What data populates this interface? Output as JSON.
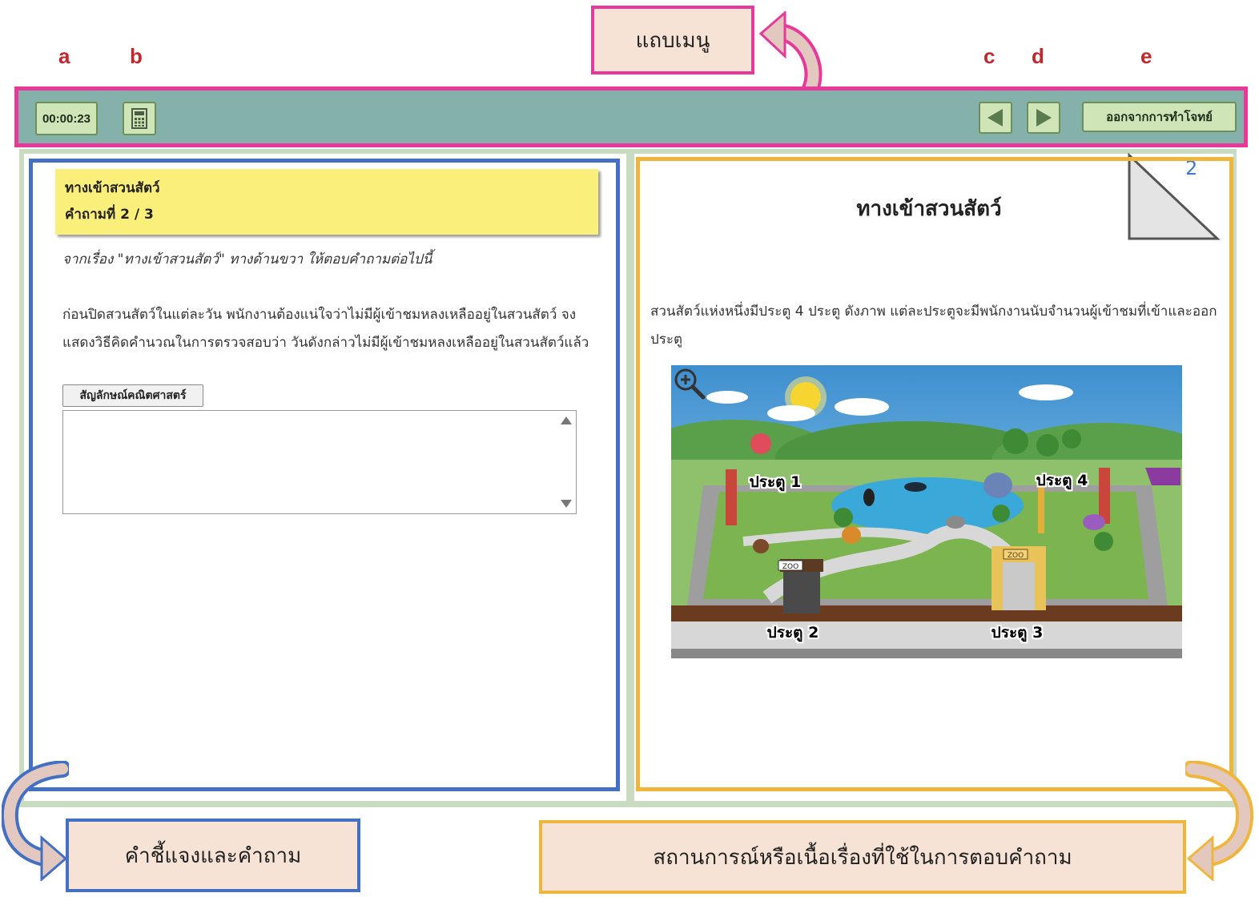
{
  "annotations": {
    "letters": [
      "a",
      "b",
      "c",
      "d",
      "e"
    ],
    "menu_callout": "แถบเมนู",
    "left_callout": "คำชี้แจงและคำถาม",
    "right_callout": "สถานการณ์หรือเนื้อเรื่องที่ใช้ในการตอบคำถาม"
  },
  "toolbar": {
    "timer": "00:00:23",
    "calculator_icon": "calculator-icon",
    "prev_icon": "triangle-left-icon",
    "next_icon": "triangle-right-icon",
    "exit_label": "ออกจากการทำโจทย์"
  },
  "question_panel": {
    "title": "ทางเข้าสวนสัตว์",
    "progress": "คำถามที่ 2 / 3",
    "instruction": "จากเรื่อง \"ทางเข้าสวนสัตว์\" ทางด้านขวา ให้ตอบคำถามต่อไปนี้",
    "question": "ก่อนปิดสวนสัตว์ในแต่ละวัน พนักงานต้องแน่ใจว่าไม่มีผู้เข้าชมหลงเหลืออยู่ในสวนสัตว์ จงแสดงวิธีคิดคำนวณในการตรวจสอบว่า วันดังกล่าวไม่มีผู้เข้าชมหลงเหลืออยู่ในสวนสัตว์แล้ว",
    "math_button": "สัญลักษณ์คณิตศาสตร์",
    "answer_value": ""
  },
  "story_panel": {
    "page_number": "2",
    "title": "ทางเข้าสวนสัตว์",
    "text": "สวนสัตว์แห่งหนึ่งมีประตู 4 ประตู ดังภาพ แต่ละประตูจะมีพนักงานนับจำนวนผู้เข้าชมที่เข้าและออกประตู",
    "zoom_icon": "zoom-in-icon",
    "image": {
      "gate_labels": [
        "ประตู 1",
        "ประตู 2",
        "ประตู 3",
        "ประตู 4"
      ],
      "signs": [
        "ZOO",
        "ZOO"
      ]
    }
  },
  "colors": {
    "toolbar_bg": "#84b2aa",
    "menu_border": "#e8399a",
    "question_border": "#4470c4",
    "story_border": "#f0b63c",
    "header_yellow": "#fbef7b",
    "button_green": "#cfe4b7",
    "letter_red": "#c0282e",
    "callout_bg": "#f6e3d6"
  }
}
